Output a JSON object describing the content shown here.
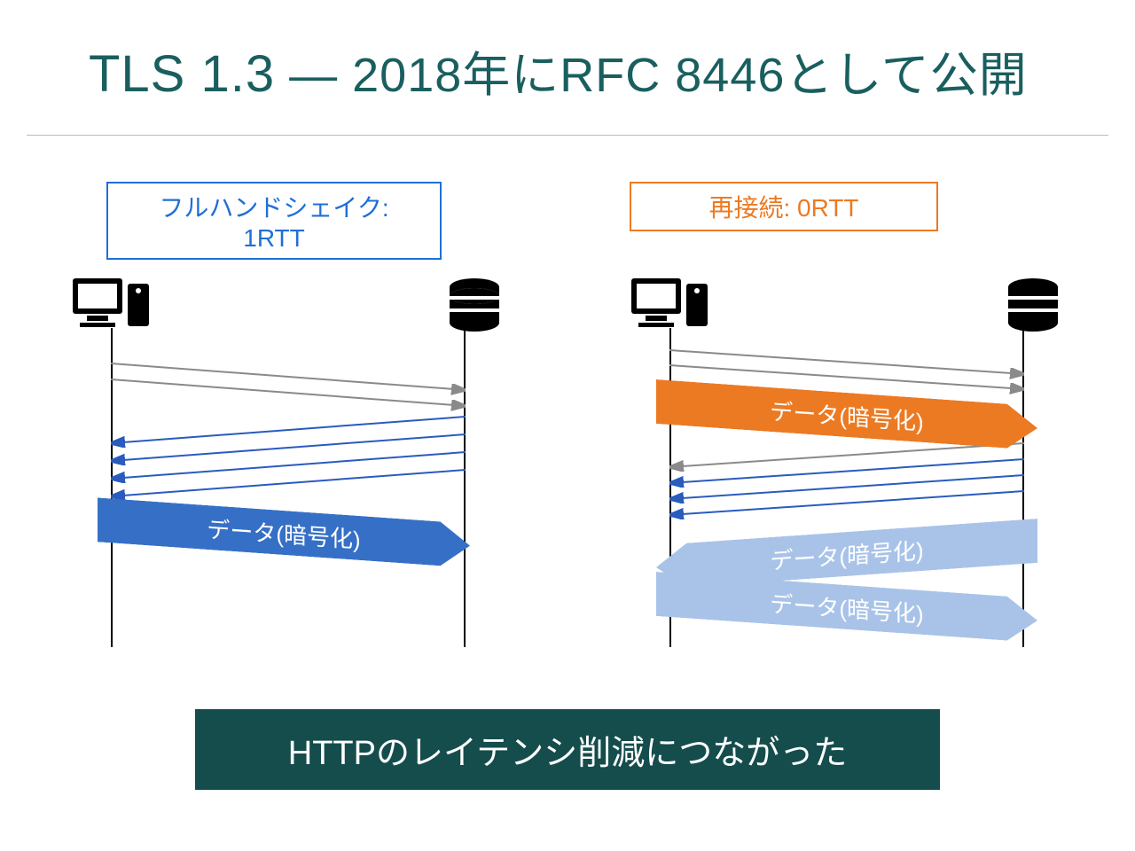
{
  "title_big": "TLS 1.3",
  "title_rest": "— 2018年にRFC 8446として公開",
  "badge_left": "フルハンドシェイク: 1RTT",
  "badge_right": "再接続: 0RTT",
  "data_label": "データ(暗号化)",
  "banner": "HTTPのレイテンシ削減につながった"
}
